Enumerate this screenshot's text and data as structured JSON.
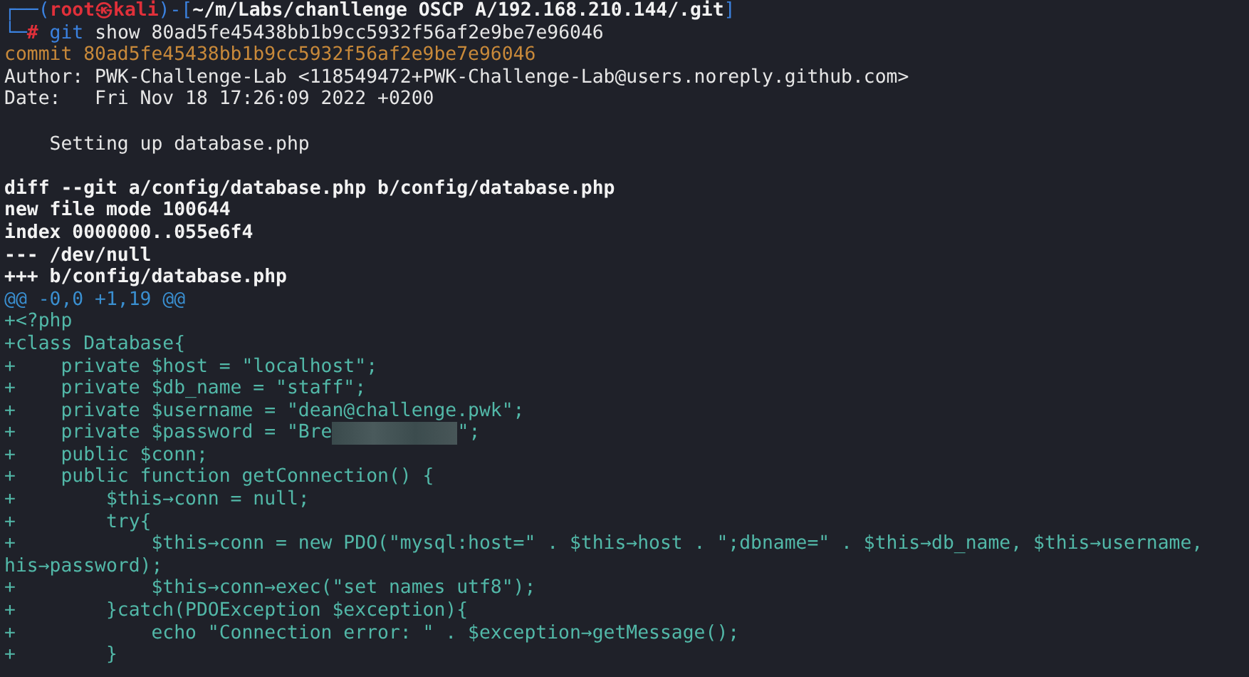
{
  "terminal": {
    "lines": [
      {
        "kind": "prompt_head",
        "open": "┌──(",
        "user": "root㉿kali",
        "mid": ")-[",
        "path": "~/m/Labs/chanllenge OSCP A/192.168.210.144/.git",
        "close": "]"
      },
      {
        "kind": "prompt_cmd",
        "corner": "└─",
        "symbol": "#",
        "command": "git",
        "args": "show 80ad5fe45438bb1b9cc5932f56af2e9be7e96046"
      },
      {
        "kind": "commit",
        "text": "commit 80ad5fe45438bb1b9cc5932f56af2e9be7e96046"
      },
      {
        "kind": "plain",
        "text": "Author: PWK-Challenge-Lab <118549472+PWK-Challenge-Lab@users.noreply.github.com>"
      },
      {
        "kind": "plain",
        "text": "Date:   Fri Nov 18 17:26:09 2022 +0200"
      },
      {
        "kind": "blank"
      },
      {
        "kind": "plain",
        "text": "    Setting up database.php"
      },
      {
        "kind": "blank"
      },
      {
        "kind": "header",
        "text": "diff --git a/config/database.php b/config/database.php"
      },
      {
        "kind": "header",
        "text": "new file mode 100644"
      },
      {
        "kind": "header",
        "text": "index 0000000..055e6f4"
      },
      {
        "kind": "header",
        "text": "--- /dev/null"
      },
      {
        "kind": "header",
        "text": "+++ b/config/database.php"
      },
      {
        "kind": "hunk",
        "text": "@@ -0,0 +1,19 @@"
      },
      {
        "kind": "add",
        "text": "+<?php"
      },
      {
        "kind": "add",
        "text": "+class Database{"
      },
      {
        "kind": "add",
        "text": "+    private $host = \"localhost\";"
      },
      {
        "kind": "add",
        "text": "+    private $db_name = \"staff\";"
      },
      {
        "kind": "add",
        "text": "+    private $username = \"dean@challenge.pwk\";"
      },
      {
        "kind": "redacted",
        "before": "+    private $password = \"Bre",
        "after": "\";"
      },
      {
        "kind": "add",
        "text": "+    public $conn;"
      },
      {
        "kind": "add",
        "text": "+    public function getConnection() {"
      },
      {
        "kind": "add",
        "text": "+        $this→conn = null;"
      },
      {
        "kind": "add",
        "text": "+        try{"
      },
      {
        "kind": "add",
        "text": "+            $this→conn = new PDO(\"mysql:host=\" . $this→host . \";dbname=\" . $this→db_name, $this→username,"
      },
      {
        "kind": "add",
        "text": "his→password);"
      },
      {
        "kind": "add",
        "text": "+            $this→conn→exec(\"set names utf8\");"
      },
      {
        "kind": "add",
        "text": "+        }catch(PDOException $exception){"
      },
      {
        "kind": "add",
        "text": "+            echo \"Connection error: \" . $exception→getMessage();"
      },
      {
        "kind": "add",
        "text": "+        }"
      }
    ]
  }
}
